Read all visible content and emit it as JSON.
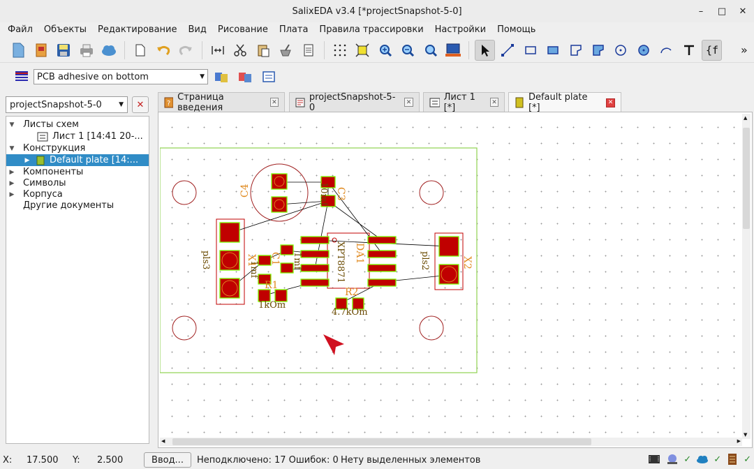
{
  "window": {
    "title": "SalixEDA v3.4 [*projectSnapshot-5-0]",
    "minimize": "–",
    "maximize": "□",
    "close": "✕"
  },
  "menu": [
    "Файл",
    "Объекты",
    "Редактирование",
    "Вид",
    "Рисование",
    "Плата",
    "Правила трассировки",
    "Настройки",
    "Помощь"
  ],
  "toolbar2": {
    "layer": "PCB adhesive on bottom"
  },
  "project": {
    "name": "projectSnapshot-5-0"
  },
  "tree": {
    "schemes": "Листы схем",
    "sheet1": "Лист 1 [14:41 20-...",
    "construction": "Конструкция",
    "plate": "Default plate [14:...",
    "components": "Компоненты",
    "symbols": "Символы",
    "packages": "Корпуса",
    "other": "Другие документы"
  },
  "tabs": [
    "Страница введения",
    "projectSnapshot-5-0",
    "Лист 1 [*]",
    "Default plate [*]"
  ],
  "pcb": {
    "labels": {
      "c4": "C4",
      "c3": "C3",
      "c3v": "10mf",
      "x1": "X1",
      "pls3": "pls3",
      "c1": "C1",
      "c1v": "1mf",
      "c2v": "1mf",
      "r1": "R1",
      "r1v": "1kOm",
      "da1": "DA1",
      "xpt": "XPT8871",
      "r2": "R2",
      "r2v": "4.7kOm",
      "x2": "X2",
      "pls2": "pls2"
    }
  },
  "status": {
    "x_label": "X:",
    "x_value": "17.500",
    "y_label": "Y:",
    "y_value": "2.500",
    "input_btn": "Ввод...",
    "unconnected": "Неподключено: 17 Ошибок: 0",
    "selection": "Нету выделенных элементов",
    "check": "✓"
  },
  "colors": {
    "selection": "#308cc6",
    "board_outline": "#8fd14f",
    "pad": "#c00000",
    "silk": "#e08a20",
    "ratsnest": "#000000"
  }
}
